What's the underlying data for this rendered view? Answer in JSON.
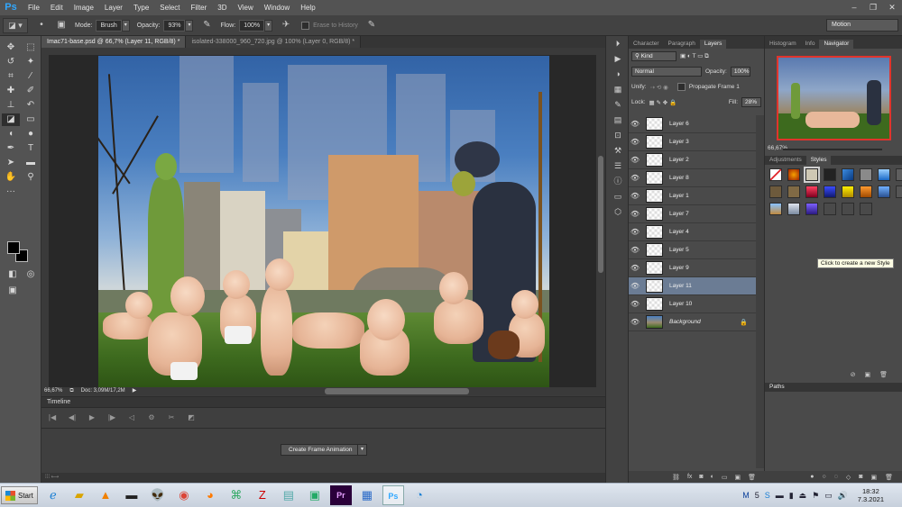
{
  "menubar": {
    "logo": "Ps",
    "items": [
      "File",
      "Edit",
      "Image",
      "Layer",
      "Type",
      "Select",
      "Filter",
      "3D",
      "View",
      "Window",
      "Help"
    ]
  },
  "options": {
    "mode_label": "Mode:",
    "mode_value": "Brush",
    "opacity_label": "Opacity:",
    "opacity_value": "93%",
    "flow_label": "Flow:",
    "flow_value": "100%",
    "erase_history_label": "Erase to History",
    "workspace": "Motion"
  },
  "tabs": [
    {
      "label": "Imac71-base.psd @ 66,7% (Layer 11, RGB/8) *",
      "active": true
    },
    {
      "label": "isolated-338000_960_720.jpg @ 100% (Layer 0, RGB/8) *",
      "active": false
    }
  ],
  "status": {
    "zoom": "66,67%",
    "doc": "Doc: 3,09M/17,2M"
  },
  "timeline": {
    "title": "Timeline",
    "create_button": "Create Frame Animation"
  },
  "layers_panel": {
    "tabs": [
      "Character",
      "Paragraph",
      "Layers"
    ],
    "active_tab": "Layers",
    "kind_label": "Kind",
    "blend_mode": "Normal",
    "opacity_label": "Opacity:",
    "opacity_value": "100%",
    "unify_label": "Unify:",
    "propagate_label": "Propagate Frame 1",
    "lock_label": "Lock:",
    "fill_label": "Fill:",
    "fill_value": "28%",
    "layers": [
      {
        "name": "Layer 6"
      },
      {
        "name": "Layer 3"
      },
      {
        "name": "Layer 2"
      },
      {
        "name": "Layer 8"
      },
      {
        "name": "Layer 1"
      },
      {
        "name": "Layer 7"
      },
      {
        "name": "Layer 4"
      },
      {
        "name": "Layer 5"
      },
      {
        "name": "Layer 9"
      },
      {
        "name": "Layer 11"
      },
      {
        "name": "Layer 10"
      },
      {
        "name": "Background"
      }
    ]
  },
  "navigator_panel": {
    "tabs": [
      "Histogram",
      "Info",
      "Navigator"
    ],
    "active_tab": "Navigator",
    "zoom": "66,67%"
  },
  "styles_panel": {
    "tabs": [
      "Adjustments",
      "Styles"
    ],
    "active_tab": "Styles",
    "tooltip": "Click to create a new Style"
  },
  "paths_panel": {
    "title": "Paths"
  },
  "taskbar": {
    "start_label": "Start",
    "time": "18:32",
    "date": "7.3.2021"
  }
}
